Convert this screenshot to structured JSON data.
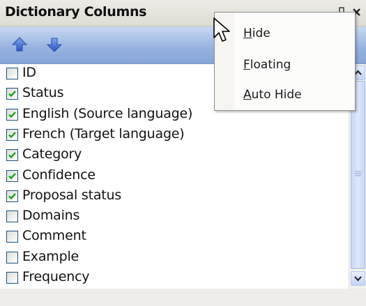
{
  "panel": {
    "title": "Dictionary Columns",
    "pin_glyph": "ㅁ",
    "close_glyph": "✕"
  },
  "toolbar": {
    "move_up_icon": "arrow-up-icon",
    "move_down_icon": "arrow-down-icon"
  },
  "columns": [
    {
      "label": "ID",
      "checked": false
    },
    {
      "label": "Status",
      "checked": true
    },
    {
      "label": "English (Source language)",
      "checked": true
    },
    {
      "label": "French (Target language)",
      "checked": true
    },
    {
      "label": "Category",
      "checked": true
    },
    {
      "label": "Confidence",
      "checked": true
    },
    {
      "label": "Proposal status",
      "checked": true
    },
    {
      "label": "Domains",
      "checked": false
    },
    {
      "label": "Comment",
      "checked": false
    },
    {
      "label": "Example",
      "checked": false
    },
    {
      "label": "Frequency",
      "checked": false
    }
  ],
  "context_menu": {
    "items": [
      {
        "label": "Hide",
        "mnemonic": "H",
        "rest": "ide"
      },
      {
        "label": "Floating",
        "mnemonic": "F",
        "rest": "loating"
      },
      {
        "label": "Auto Hide",
        "mnemonic": "A",
        "rest": "uto Hide"
      }
    ]
  },
  "colors": {
    "toolbar": "#95b1df",
    "checkmark": "#21a121",
    "arrow": "#3a64c8"
  }
}
